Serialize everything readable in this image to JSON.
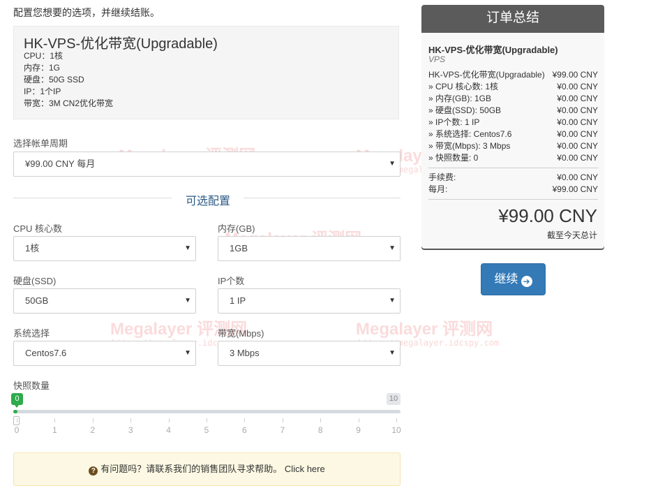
{
  "intro_text": "配置您想要的选项，并继续结账。",
  "product": {
    "title": "HK-VPS-优化带宽(Upgradable)",
    "specs": [
      "CPU：1核",
      "内存：1G",
      "硬盘：50G SSD",
      "IP：1个IP",
      "带宽：3M CN2优化带宽"
    ]
  },
  "billing": {
    "label": "选择帐单周期",
    "value": "¥99.00 CNY 每月"
  },
  "options_title": "可选配置",
  "fields": {
    "cpu": {
      "label": "CPU 核心数",
      "value": "1核"
    },
    "ram": {
      "label": "内存(GB)",
      "value": "1GB"
    },
    "disk": {
      "label": "硬盘(SSD)",
      "value": "50GB"
    },
    "ip": {
      "label": "IP个数",
      "value": "1 IP"
    },
    "os": {
      "label": "系统选择",
      "value": "Centos7.6"
    },
    "bandwidth": {
      "label": "带宽(Mbps)",
      "value": "3 Mbps"
    }
  },
  "snapshot": {
    "label": "快照数量",
    "min": "0",
    "max": "10",
    "value": 0,
    "ticks": [
      "0",
      "1",
      "2",
      "3",
      "4",
      "5",
      "6",
      "7",
      "8",
      "9",
      "10"
    ]
  },
  "help": {
    "text": "有问题吗？请联系我们的销售团队寻求帮助。",
    "link": "Click here",
    "icon": "question-circle-icon"
  },
  "watermark": {
    "text": "Megalayer 评测网",
    "url": "https://megalayer.idcspy.com"
  },
  "summary": {
    "title": "订单总结",
    "product_name": "HK-VPS-优化带宽(Upgradable)",
    "group": "VPS",
    "lines": [
      {
        "label": "HK-VPS-优化带宽(Upgradable)",
        "price": "¥99.00 CNY"
      },
      {
        "label": "» CPU 核心数: 1核",
        "price": "¥0.00 CNY"
      },
      {
        "label": "» 内存(GB): 1GB",
        "price": "¥0.00 CNY"
      },
      {
        "label": "» 硬盘(SSD): 50GB",
        "price": "¥0.00 CNY"
      },
      {
        "label": "» IP个数: 1 IP",
        "price": "¥0.00 CNY"
      },
      {
        "label": "» 系统选择: Centos7.6",
        "price": "¥0.00 CNY"
      },
      {
        "label": "» 带宽(Mbps): 3 Mbps",
        "price": "¥0.00 CNY"
      },
      {
        "label": "» 快照数量: 0",
        "price": "¥0.00 CNY"
      }
    ],
    "fee": {
      "label": "手续费:",
      "price": "¥0.00 CNY"
    },
    "monthly": {
      "label": "每月:",
      "price": "¥99.00 CNY"
    },
    "total": "¥99.00 CNY",
    "total_label": "截至今天总计"
  },
  "continue_button": {
    "label": "继续",
    "icon": "arrow-circle-right-icon"
  },
  "colors": {
    "accent": "#337ab7",
    "slider_green": "#2eab4b",
    "summary_header": "#5b5b5b",
    "help_bg": "#fcf8e3"
  }
}
